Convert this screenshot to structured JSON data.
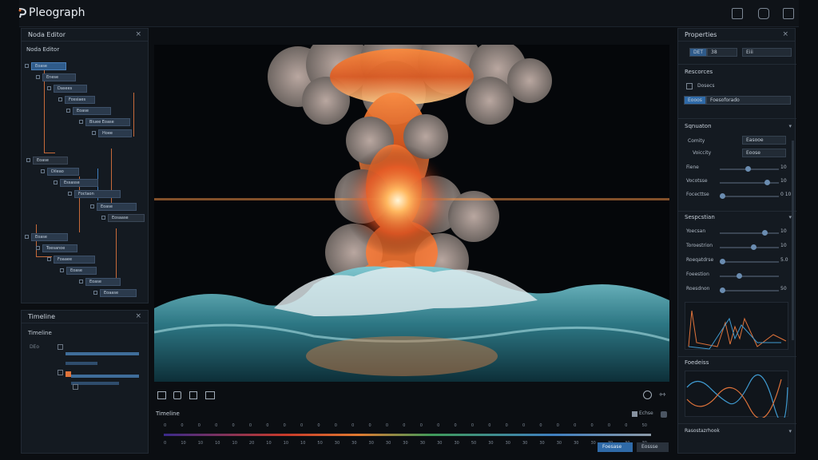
{
  "app": {
    "title": "Pleograph"
  },
  "node_editor": {
    "tab_title": "Noda Editor",
    "inner_title": "Noda Editor",
    "nodes": [
      "Eoase",
      "Enese",
      "Dasees",
      "Fossiaes",
      "Eoase",
      "Biuee Eoase",
      "Hoee",
      "Eoase",
      "Dileao",
      "Essasse",
      "Foctaon",
      "Eoase",
      "Eosaase",
      "Eoase",
      "Toesanoe",
      "Foaaee",
      "Eoase",
      "Eoase",
      "Eoaase"
    ]
  },
  "timeline_panel": {
    "tab_title": "Timeline",
    "inner_title": "Timeline",
    "label": "DEo"
  },
  "viewport_toolbar": {
    "icons": [
      "grid-icon",
      "node-icon",
      "frame-icon",
      "camera-icon"
    ]
  },
  "timeline": {
    "title": "Timeline",
    "toggle_label": "Echse",
    "ticks_top": [
      "0",
      "0",
      "0",
      "0",
      "0",
      "0",
      "0",
      "0",
      "0",
      "0",
      "0",
      "0",
      "0",
      "0",
      "0",
      "0",
      "0",
      "0",
      "0",
      "0",
      "0",
      "0",
      "0",
      "0",
      "0",
      "0",
      "0",
      "0",
      "50"
    ],
    "ticks_bottom": [
      "0",
      "10",
      "10",
      "10",
      "10",
      "20",
      "10",
      "10",
      "10",
      "50",
      "30",
      "30",
      "30",
      "30",
      "30",
      "30",
      "30",
      "30",
      "50",
      "30",
      "30",
      "30",
      "30",
      "30",
      "30",
      "30",
      "30",
      "30",
      "30"
    ],
    "btn_primary": "Foesase",
    "btn_secondary": "Eossse"
  },
  "properties": {
    "tab_title": "Properties",
    "top_fields": [
      "DET",
      "38",
      "Eiii"
    ],
    "resources": {
      "title": "Rescorces",
      "item": "Dosecs",
      "field_label": "Eooos",
      "field_value": "Foesoforado"
    },
    "simulation": {
      "title": "Sqnuaton",
      "rows": [
        {
          "label": "Comity",
          "value": "Easooe"
        },
        {
          "label": "Voiccity",
          "value": "Eoose"
        }
      ],
      "sliders": [
        {
          "label": "Fiene",
          "value": "10",
          "pos": 0.45
        },
        {
          "label": "Vocotsse",
          "value": "10",
          "pos": 0.8
        },
        {
          "label": "Focecttse",
          "value": "0 10",
          "pos": 0.0
        }
      ]
    },
    "simulation2": {
      "title": "Sespcstian",
      "sliders": [
        {
          "label": "Yoecsan",
          "value": "10",
          "pos": 0.75
        },
        {
          "label": "Toroestrion",
          "value": "10",
          "pos": 0.55
        },
        {
          "label": "Roeqatdrse",
          "value": "5.0",
          "pos": 0.0
        },
        {
          "label": "Foeestion",
          "value": "",
          "pos": 0.3
        },
        {
          "label": "Roesdnon",
          "value": "50",
          "pos": 0.0
        }
      ]
    },
    "graph2_title": "Foedeiss",
    "footer": "Rasostazrhook"
  },
  "colors": {
    "accent": "#3f7fc0",
    "orange": "#e0733a",
    "bg": "#141a21"
  }
}
